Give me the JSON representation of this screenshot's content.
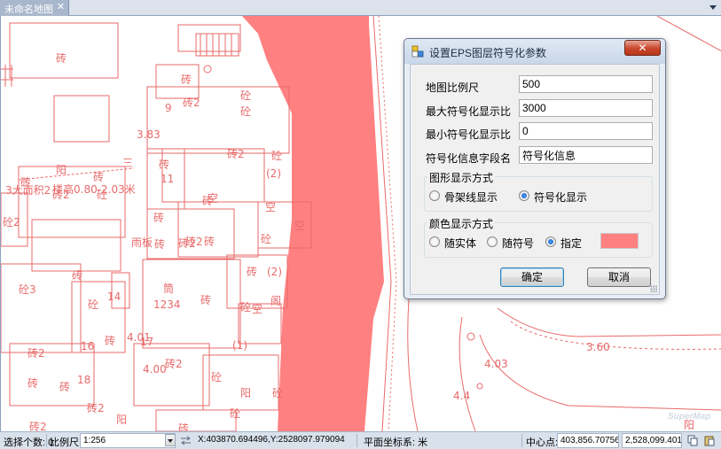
{
  "tab": {
    "title": "未命名地图",
    "close_glyph": "✕"
  },
  "map": {
    "fill_color": "#ff8080",
    "line_color": "#e96a6a",
    "logo": "SuperMap",
    "labels": [
      "砖",
      "砖",
      "9",
      "砖2",
      "砼",
      "砼",
      "3.83",
      "砖2",
      "砼",
      "砖",
      "11",
      "砖",
      "(2)",
      "阳",
      "砖",
      "砖2",
      "砖2",
      "砖",
      "砖",
      "砖",
      "三",
      "砼",
      "3大面积2",
      "楼高0.80-2.03米",
      "砼2",
      "空",
      "空",
      "空",
      "砼",
      "砖",
      "砖2",
      "砖",
      "砼",
      "雨板",
      "砖",
      "砼3",
      "14",
      "砖",
      "(2)",
      "空",
      "筒",
      "砖",
      "1234",
      "砼",
      "阁",
      "砼",
      "4.01",
      "砖2",
      "16",
      "17",
      "砖",
      "(1)",
      "4.00",
      "砖2",
      "砼",
      "砖",
      "18",
      "阳",
      "砼",
      "砖",
      "砖2",
      "阳",
      "砖2",
      "4.03",
      "4.4",
      "3.60",
      "阳"
    ]
  },
  "dialog": {
    "title": "设置EPS图层符号化参数",
    "close_glyph": "✕",
    "fields": [
      {
        "label": "地图比例尺",
        "value": "500"
      },
      {
        "label": "最大符号化显示比",
        "value": "3000"
      },
      {
        "label": "最小符号化显示比",
        "value": "0"
      },
      {
        "label": "符号化信息字段名",
        "value": "符号化信息"
      }
    ],
    "display_group": {
      "title": "图形显示方式",
      "options": [
        {
          "label": "骨架线显示",
          "selected": false
        },
        {
          "label": "符号化显示",
          "selected": true
        }
      ]
    },
    "color_group": {
      "title": "颜色显示方式",
      "options": [
        {
          "label": "随实体",
          "selected": false
        },
        {
          "label": "随符号",
          "selected": false
        },
        {
          "label": "指定",
          "selected": true
        }
      ],
      "swatch_color": "#ff8080"
    },
    "ok_label": "确定",
    "cancel_label": "取消"
  },
  "status": {
    "selection_label": "选择个数: 0",
    "scale_label": "比例尺:",
    "scale_value": "1:256",
    "coordinates": "X:403870.694496,Y:2528097.979094",
    "coord_system": "平面坐标系: 米",
    "center_label": "中心点:",
    "center_x": "403,856.707563",
    "center_y": "2,528,099.401..."
  }
}
